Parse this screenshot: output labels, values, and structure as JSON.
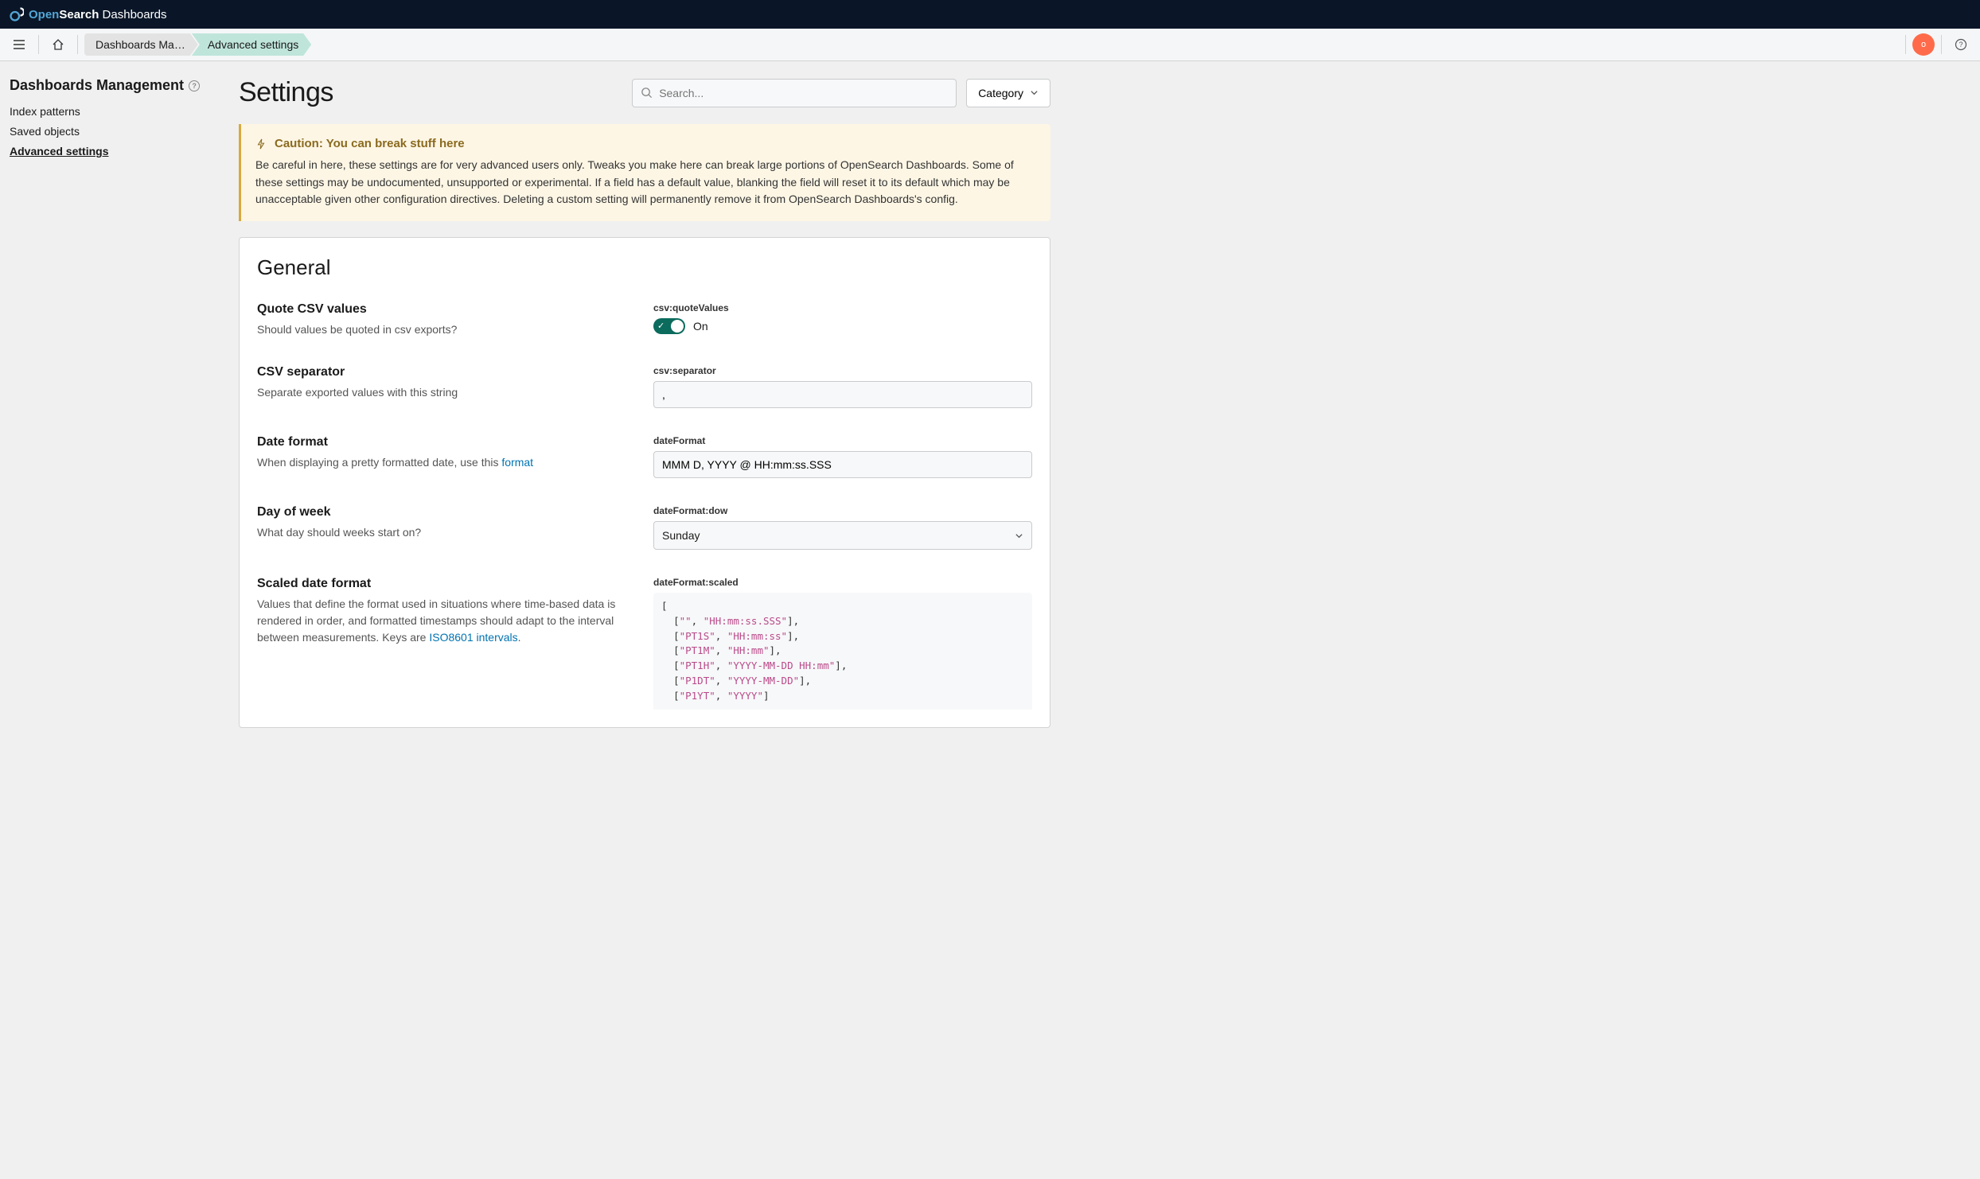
{
  "brand": {
    "name_left": "Open",
    "name_mid": "Search",
    "name_right": " Dashboards"
  },
  "crumbs": {
    "first": "Dashboards Ma…",
    "second": "Advanced settings"
  },
  "avatar_initial": "o",
  "sidebar": {
    "title": "Dashboards Management",
    "links": {
      "index": "Index patterns",
      "saved": "Saved objects",
      "advanced": "Advanced settings"
    }
  },
  "page": {
    "title": "Settings",
    "search_placeholder": "Search...",
    "category_label": "Category"
  },
  "callout": {
    "title": "Caution: You can break stuff here",
    "body": "Be careful in here, these settings are for very advanced users only. Tweaks you make here can break large portions of OpenSearch Dashboards. Some of these settings may be undocumented, unsupported or experimental. If a field has a default value, blanking the field will reset it to its default which may be unacceptable given other configuration directives. Deleting a custom setting will permanently remove it from OpenSearch Dashboards's config."
  },
  "section_title": "General",
  "settings": {
    "quote_csv": {
      "name": "Quote CSV values",
      "desc": "Should values be quoted in csv exports?",
      "key": "csv:quoteValues",
      "state": "On"
    },
    "csv_sep": {
      "name": "CSV separator",
      "desc": "Separate exported values with this string",
      "key": "csv:separator",
      "value": ","
    },
    "date_fmt": {
      "name": "Date format",
      "desc_pre": "When displaying a pretty formatted date, use this ",
      "desc_link": "format",
      "key": "dateFormat",
      "value": "MMM D, YYYY @ HH:mm:ss.SSS"
    },
    "dow": {
      "name": "Day of week",
      "desc": "What day should weeks start on?",
      "key": "dateFormat:dow",
      "value": "Sunday"
    },
    "scaled": {
      "name": "Scaled date format",
      "desc_pre": "Values that define the format used in situations where time-based data is rendered in order, and formatted timestamps should adapt to the interval between measurements. Keys are ",
      "desc_link": "ISO8601 intervals",
      "desc_post": ".",
      "key": "dateFormat:scaled",
      "rows": [
        [
          "",
          "HH:mm:ss.SSS"
        ],
        [
          "PT1S",
          "HH:mm:ss"
        ],
        [
          "PT1M",
          "HH:mm"
        ],
        [
          "PT1H",
          "YYYY-MM-DD HH:mm"
        ],
        [
          "P1DT",
          "YYYY-MM-DD"
        ],
        [
          "P1YT",
          "YYYY"
        ]
      ]
    }
  }
}
